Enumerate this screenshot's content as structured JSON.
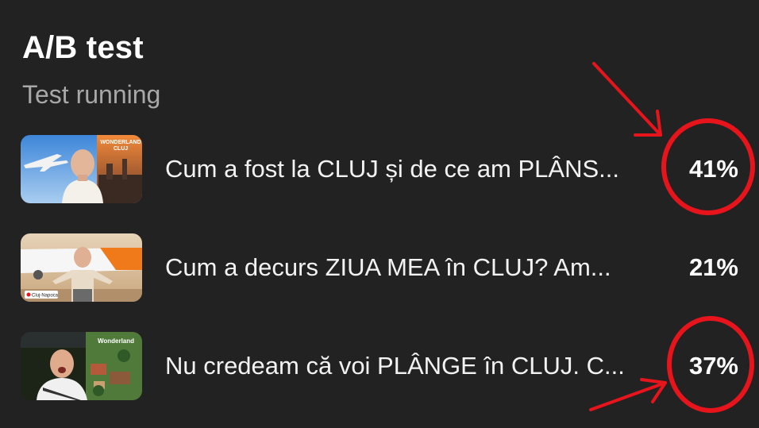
{
  "header": {
    "title": "A/B test",
    "status": "Test running"
  },
  "variants": [
    {
      "title": "Cum a fost la CLUJ și de ce am PLÂNS...",
      "percent": "41%",
      "highlighted": true,
      "thumbnail_icon": "video-thumbnail",
      "thumbnail_text": [
        "WONDERLAND",
        "CLUJ"
      ]
    },
    {
      "title": "Cum a decurs ZIUA MEA în CLUJ? Am...",
      "percent": "21%",
      "highlighted": false,
      "thumbnail_icon": "video-thumbnail",
      "thumbnail_text": [
        "Cluj-Napoca"
      ]
    },
    {
      "title": "Nu credeam că voi PLÂNGE în CLUJ. C...",
      "percent": "37%",
      "highlighted": true,
      "thumbnail_icon": "video-thumbnail",
      "thumbnail_text": [
        "Wonderland"
      ]
    }
  ],
  "annotation": {
    "color": "#e8141c",
    "shapes": [
      "red-circle",
      "red-arrow"
    ]
  },
  "colors": {
    "background": "#222222",
    "text": "#ffffff",
    "muted": "#a8a8a8"
  }
}
